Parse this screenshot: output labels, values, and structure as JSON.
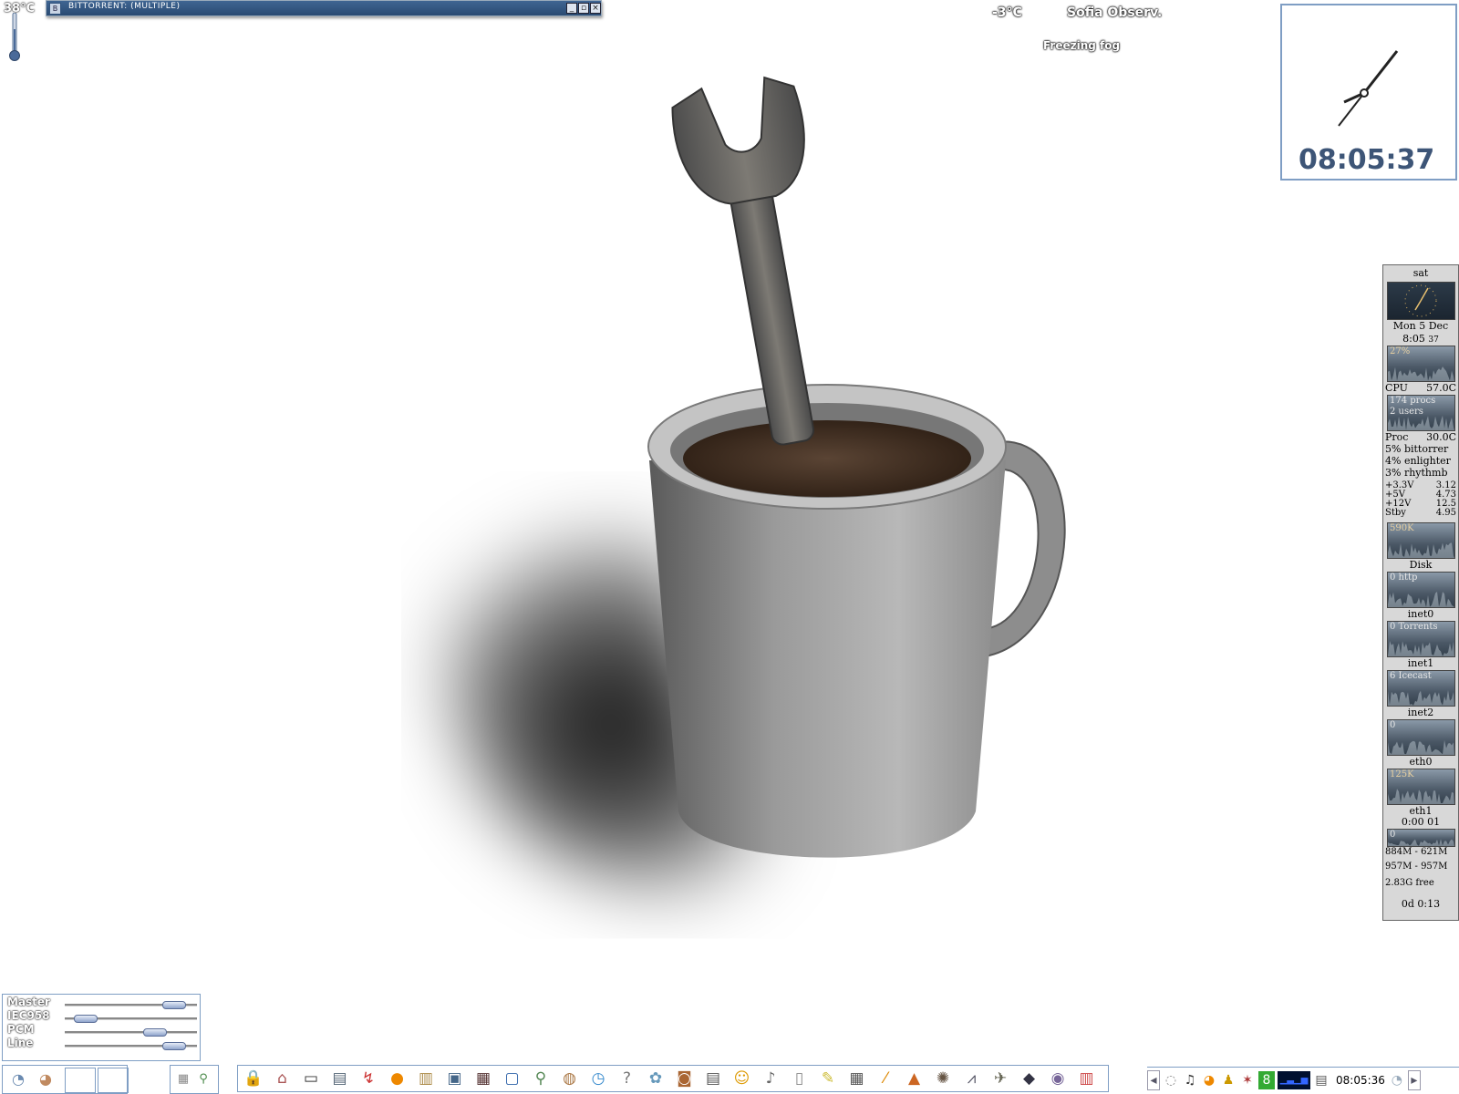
{
  "thermometer": {
    "temp": "38°C"
  },
  "window_bar": {
    "title": "BitTorrent: (multiple)",
    "buttons": [
      "minimize",
      "maximize",
      "close"
    ]
  },
  "weather": {
    "temp": "-3°C",
    "station": "Sofia Observ.",
    "condition": "Freezing fog"
  },
  "clock": {
    "digital": "08:05:37"
  },
  "gkrellm": {
    "host": "sat",
    "date": "Mon  5  Dec",
    "time": "8:05",
    "time_sec": "37",
    "cpu_chart_label": "27%",
    "cpu_label": "CPU",
    "cpu_temp": "57.0C",
    "procs_label": "174 procs",
    "users_label": "2  users",
    "proc_label": "Proc",
    "proc_temp": "30.0C",
    "top_procs": [
      "5% bittorrer",
      "4% enlighter",
      "3% rhythmb"
    ],
    "voltages": [
      {
        "name": "+3.3V",
        "value": "3.12"
      },
      {
        "name": "+5V",
        "value": "4.73"
      },
      {
        "name": "+12V",
        "value": "12.5"
      },
      {
        "name": "Stby",
        "value": "4.95"
      }
    ],
    "disk_chart_label": "590K",
    "disk_label": "Disk",
    "inet0_chart": "0 http",
    "inet0_label": "inet0",
    "inet1_chart": "0 Torrents",
    "inet1_label": "inet1",
    "inet2_chart": "6 Icecast",
    "inet2_label": "inet2",
    "eth0_chart": "0",
    "eth0_label": "eth0",
    "eth1_chart": "125K",
    "eth1_label": "eth1",
    "eth1_time": "0:00  01",
    "misc_chart": "0",
    "mem": "884M - 621M",
    "swap": "957M - 957M",
    "fs_free": "2.83G free",
    "uptime": "0d  0:13"
  },
  "mixer": {
    "channels": [
      {
        "label": "Master",
        "level": 0.9
      },
      {
        "label": "IEC958",
        "level": 0.08
      },
      {
        "label": "PCM",
        "level": 0.72
      },
      {
        "label": "Line",
        "level": 0.9
      }
    ]
  },
  "launcher": {
    "icons": [
      "lock-icon",
      "home-icon",
      "terminal-icon",
      "file-manager-icon",
      "pdf-icon",
      "orange-app-icon",
      "archive-icon",
      "image-viewer-icon",
      "video-icon",
      "screen-icon",
      "search-icon",
      "network-icon",
      "clock-app-icon",
      "help-icon",
      "kde-icon",
      "package-icon",
      "text-editor-icon",
      "chat-icon",
      "music-icon",
      "document-icon",
      "notes-icon",
      "calendar-icon",
      "pencil-icon",
      "matlab-icon",
      "gimp-icon",
      "chart-icon",
      "plane-icon",
      "eye-icon",
      "cd-icon",
      "trash-icon"
    ]
  },
  "tray": {
    "time": "08:05:36"
  },
  "colors": {
    "accent": "#7f9ec4",
    "titlebar": "#2a4a72",
    "clock_text": "#3d5577"
  }
}
